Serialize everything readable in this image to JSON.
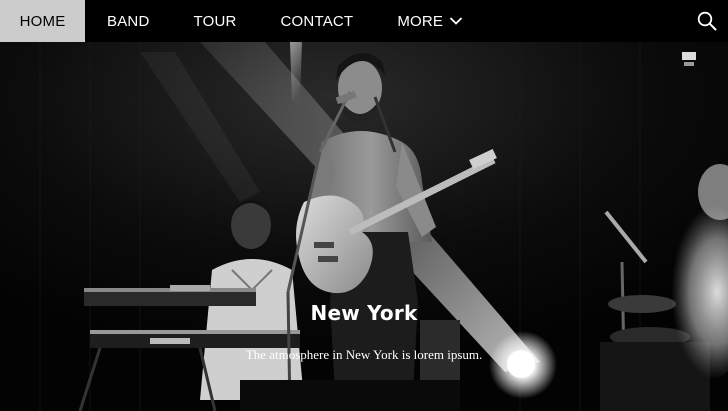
{
  "nav": {
    "items": [
      {
        "label": "HOME",
        "active": true
      },
      {
        "label": "BAND",
        "active": false
      },
      {
        "label": "TOUR",
        "active": false
      },
      {
        "label": "CONTACT",
        "active": false
      },
      {
        "label": "MORE",
        "active": false
      }
    ],
    "more_icon": "chevron-down-icon",
    "search_icon": "search-icon"
  },
  "hero": {
    "title": "New York",
    "caption": "The atmosphere in New York is lorem ipsum."
  },
  "colors": {
    "nav_background": "#000000",
    "nav_active_background": "#cccccc",
    "nav_text": "#ffffff",
    "nav_active_text": "#000000",
    "caption_text": "#ffffff"
  }
}
